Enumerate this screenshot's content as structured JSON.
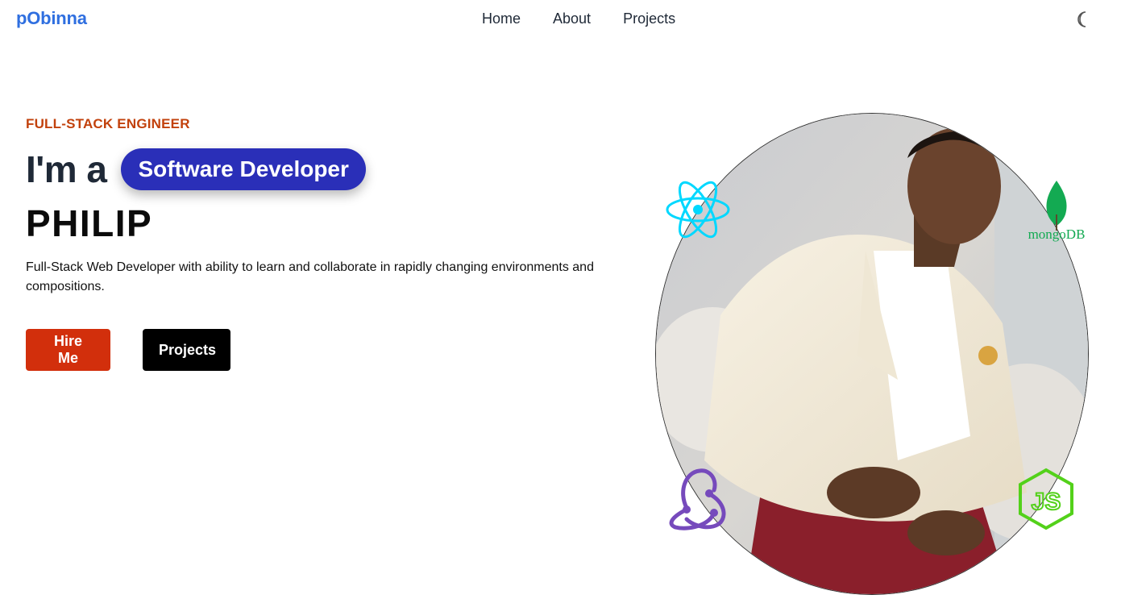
{
  "header": {
    "logo": "pObinna",
    "nav": [
      {
        "label": "Home"
      },
      {
        "label": "About"
      },
      {
        "label": "Projects"
      }
    ],
    "theme_toggle_icon": "moon-icon"
  },
  "hero": {
    "eyebrow": "FULL-STACK ENGINEER",
    "intro": "I'm a",
    "role": "Software Developer",
    "name": "PHILIP",
    "bio": "Full-Stack Web Developer with ability to learn and collaborate in rapidly changing environments and compositions.",
    "buttons": {
      "hire": "Hire Me",
      "projects": "Projects"
    }
  },
  "portrait": {
    "subject": "portrait-photo",
    "tech_icons": [
      "react-icon",
      "mongodb-icon",
      "redux-icon",
      "nodejs-icon"
    ],
    "mongo_wordmark": "mongoDB",
    "node_wordmark": "JS"
  },
  "colors": {
    "logo": "#2f6fe0",
    "eyebrow": "#c2410c",
    "role_pill": "#2a2fb8",
    "hire_button": "#d22f0c",
    "projects_button": "#000000",
    "react": "#00d8ff",
    "mongodb": "#13aa52",
    "redux": "#764abc",
    "nodejs": "#53d11a"
  }
}
